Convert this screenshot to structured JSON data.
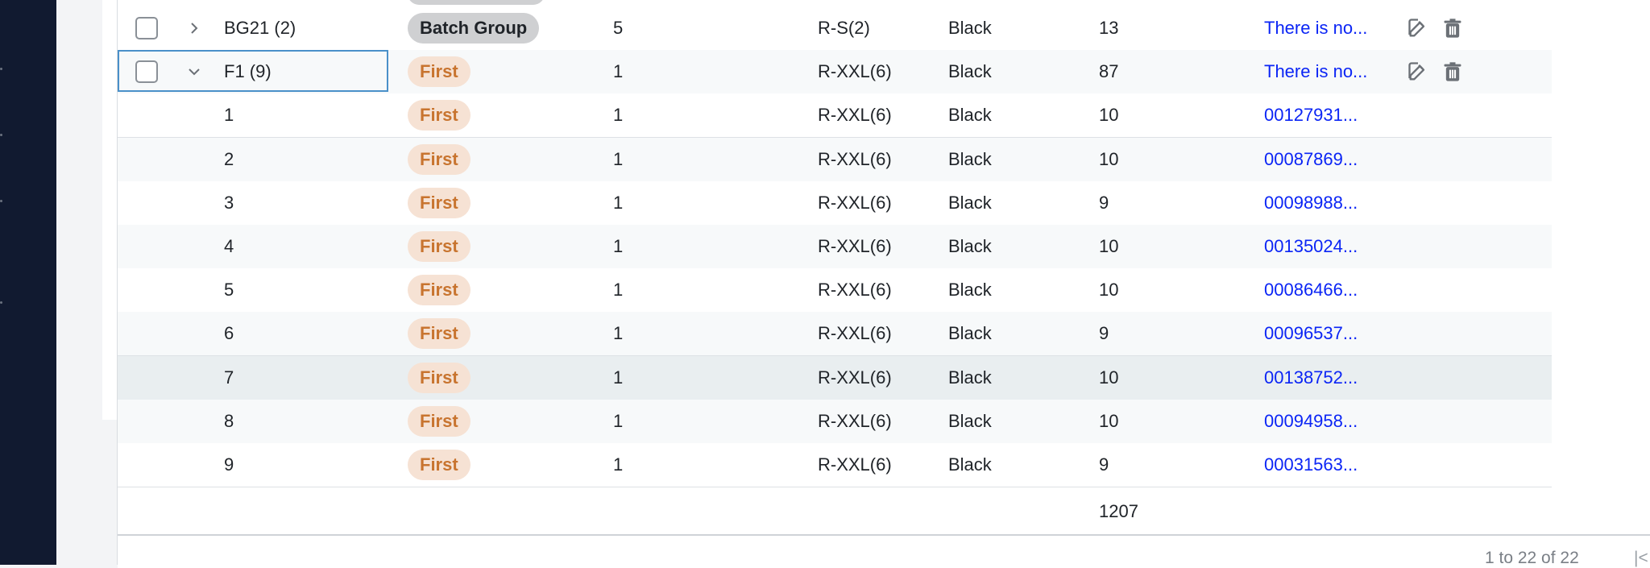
{
  "grid": {
    "rows": [
      {
        "group": "BG21 (2)",
        "type": "Batch Group",
        "type_style": "batch",
        "qty": "5",
        "size": "R-S(2)",
        "color": "Black",
        "count": "13",
        "link": "There is no...",
        "checkbox": true,
        "chevron": "right",
        "actions": true,
        "stripe": "odd"
      },
      {
        "group": "F1 (9)",
        "type": "First",
        "type_style": "first",
        "qty": "1",
        "size": "R-XXL(6)",
        "color": "Black",
        "count": "87",
        "link": "There is no...",
        "checkbox": true,
        "chevron": "down",
        "actions": true,
        "stripe": "even",
        "focused": true
      },
      {
        "group": "1",
        "type": "First",
        "type_style": "first",
        "qty": "1",
        "size": "R-XXL(6)",
        "color": "Black",
        "count": "10",
        "link": "00127931...",
        "stripe": "odd"
      },
      {
        "group": "2",
        "type": "First",
        "type_style": "first",
        "qty": "1",
        "size": "R-XXL(6)",
        "color": "Black",
        "count": "10",
        "link": "00087869...",
        "stripe": "even"
      },
      {
        "group": "3",
        "type": "First",
        "type_style": "first",
        "qty": "1",
        "size": "R-XXL(6)",
        "color": "Black",
        "count": "9",
        "link": "00098988...",
        "stripe": "odd"
      },
      {
        "group": "4",
        "type": "First",
        "type_style": "first",
        "qty": "1",
        "size": "R-XXL(6)",
        "color": "Black",
        "count": "10",
        "link": "00135024...",
        "stripe": "even"
      },
      {
        "group": "5",
        "type": "First",
        "type_style": "first",
        "qty": "1",
        "size": "R-XXL(6)",
        "color": "Black",
        "count": "10",
        "link": "00086466...",
        "stripe": "odd"
      },
      {
        "group": "6",
        "type": "First",
        "type_style": "first",
        "qty": "1",
        "size": "R-XXL(6)",
        "color": "Black",
        "count": "9",
        "link": "00096537...",
        "stripe": "even"
      },
      {
        "group": "7",
        "type": "First",
        "type_style": "first",
        "qty": "1",
        "size": "R-XXL(6)",
        "color": "Black",
        "count": "10",
        "link": "00138752...",
        "stripe": "hover"
      },
      {
        "group": "8",
        "type": "First",
        "type_style": "first",
        "qty": "1",
        "size": "R-XXL(6)",
        "color": "Black",
        "count": "10",
        "link": "00094958...",
        "stripe": "even"
      },
      {
        "group": "9",
        "type": "First",
        "type_style": "first",
        "qty": "1",
        "size": "R-XXL(6)",
        "color": "Black",
        "count": "9",
        "link": "00031563...",
        "stripe": "odd"
      }
    ],
    "total": "1207",
    "pagination_summary": "1 to 22 of 22"
  },
  "icons": {
    "edit": "edit-icon",
    "delete": "trash-icon",
    "expand": "chevron-right-icon",
    "collapse": "chevron-down-icon",
    "first_page": "first-page-icon"
  },
  "colors": {
    "sidebar": "#111a30",
    "link": "#0b25f5",
    "first_badge_bg": "#f6e2d4",
    "first_badge_text": "#c8742f",
    "batch_badge_bg": "#cfd0d2",
    "focus_border": "#4a90c9"
  }
}
